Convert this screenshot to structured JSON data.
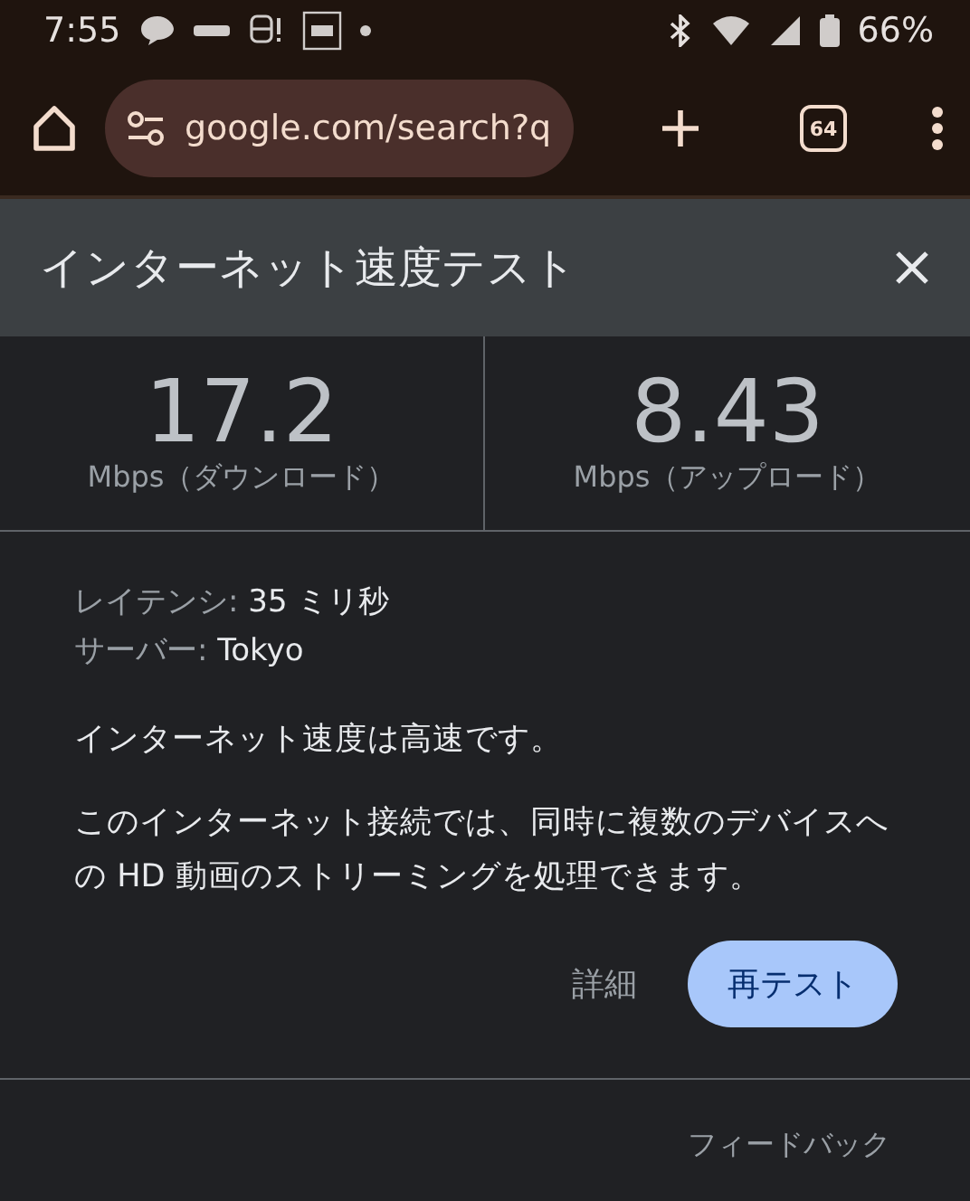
{
  "status_bar": {
    "time": "7:55",
    "battery": "66%"
  },
  "browser_toolbar": {
    "url": "google.com/search?q",
    "tab_count": "64"
  },
  "dialog": {
    "title": "インターネット速度テスト",
    "results": [
      {
        "value": "17.2",
        "unit": "Mbps（ダウンロード）"
      },
      {
        "value": "8.43",
        "unit": "Mbps（アップロード）"
      }
    ],
    "details": [
      {
        "label": "レイテンシ:",
        "value": "35 ミリ秒"
      },
      {
        "label": "サーバー:",
        "value": "Tokyo"
      }
    ],
    "summary": "インターネット速度は高速です。",
    "description": "このインターネット接続では、同時に複数のデバイスへの HD 動画のストリーミングを処理できます。",
    "actions": [
      {
        "label": "詳細",
        "kind": "text"
      },
      {
        "label": "再テスト",
        "kind": "filled"
      }
    ],
    "feedback": "フィードバック"
  }
}
